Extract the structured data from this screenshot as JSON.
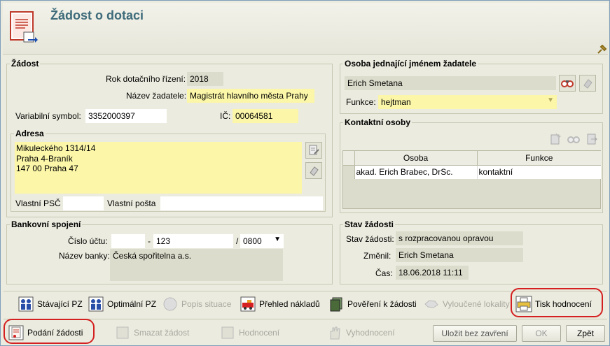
{
  "title": "Žádost o dotaci",
  "zadost": {
    "legend": "Žádost",
    "rok_label": "Rok dotačního řízení:",
    "rok_value": "2018",
    "nazev_label": "Název žadatele:",
    "nazev_value": "Magistrát hlavního města Prahy",
    "vs_label": "Variabilní symbol:",
    "vs_value": "3352000397",
    "ic_label": "IČ:",
    "ic_value": "00064581"
  },
  "adresa": {
    "legend": "Adresa",
    "lines": [
      "Mikuleckého 1314/14",
      "Praha 4-Braník",
      "147 00 Praha 47"
    ],
    "psc_label": "Vlastní PSČ",
    "psc_value": "",
    "posta_label": "Vlastní pošta",
    "posta_value": ""
  },
  "osoba": {
    "legend": "Osoba jednající jménem žadatele",
    "name": "Erich Smetana",
    "funkce_label": "Funkce:",
    "funkce_value": "hejtman"
  },
  "kontakt": {
    "legend": "Kontaktní osoby",
    "columns": [
      "Osoba",
      "Funkce"
    ],
    "rows": [
      [
        "akad. Erich Brabec, DrSc.",
        "kontaktní"
      ]
    ]
  },
  "bank": {
    "legend": "Bankovní spojení",
    "cislo_label": "Číslo účtu:",
    "prefix": "",
    "dash": "-",
    "account": "123",
    "slash": "/",
    "bank_code": "0800",
    "nazev_label": "Název banky:",
    "nazev_value": "Česká spořitelna a.s."
  },
  "stav": {
    "legend": "Stav žádosti",
    "stav_label": "Stav žádosti:",
    "stav_value": "s rozpracovanou opravou",
    "zmenil_label": "Změnil:",
    "zmenil_value": "Erich Smetana",
    "cas_label": "Čas:",
    "cas_value": "18.06.2018 11:11"
  },
  "toolbar1": {
    "stavajici": "Stávající PZ",
    "optimalni": "Optimální PZ",
    "popis": "Popis situace",
    "prehled": "Přehled nákladů",
    "povereni": "Pověření k žádosti",
    "vyloucene": "Vyloučené lokality",
    "tisk": "Tisk hodnocení"
  },
  "toolbar2": {
    "podani": "Podání žádosti",
    "smazat": "Smazat žádost",
    "hodnoceni": "Hodnocení",
    "vyhodnoceni": "Vyhodnocení",
    "ulozit": "Uložit bez zavření",
    "ok": "OK",
    "zpet": "Zpět"
  },
  "colors": {
    "title": "#3e6b7a",
    "highlight": "#d42020",
    "required": "#fbf6a8"
  }
}
